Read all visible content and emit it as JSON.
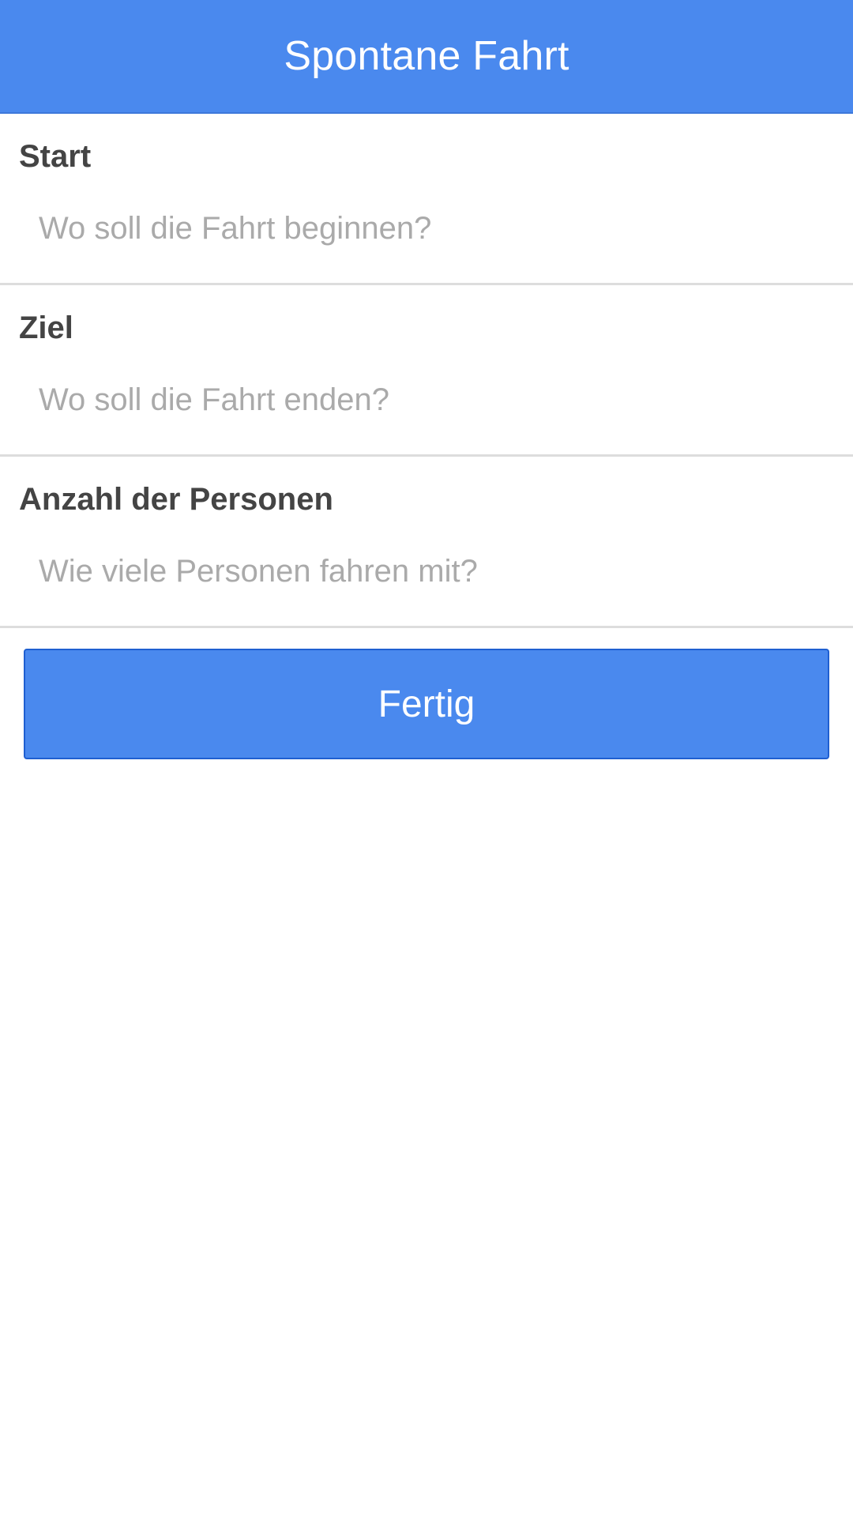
{
  "header": {
    "title": "Spontane Fahrt"
  },
  "form": {
    "fields": [
      {
        "label": "Start",
        "placeholder": "Wo soll die Fahrt beginnen?",
        "value": ""
      },
      {
        "label": "Ziel",
        "placeholder": "Wo soll die Fahrt enden?",
        "value": ""
      },
      {
        "label": "Anzahl der Personen",
        "placeholder": "Wie viele Personen fahren mit?",
        "value": ""
      }
    ],
    "submit_label": "Fertig"
  },
  "colors": {
    "accent": "#4a89ee",
    "button_border": "#1f5fd1",
    "label_text": "#444444",
    "placeholder_text": "#aaaaaa",
    "divider": "#dddddd"
  }
}
